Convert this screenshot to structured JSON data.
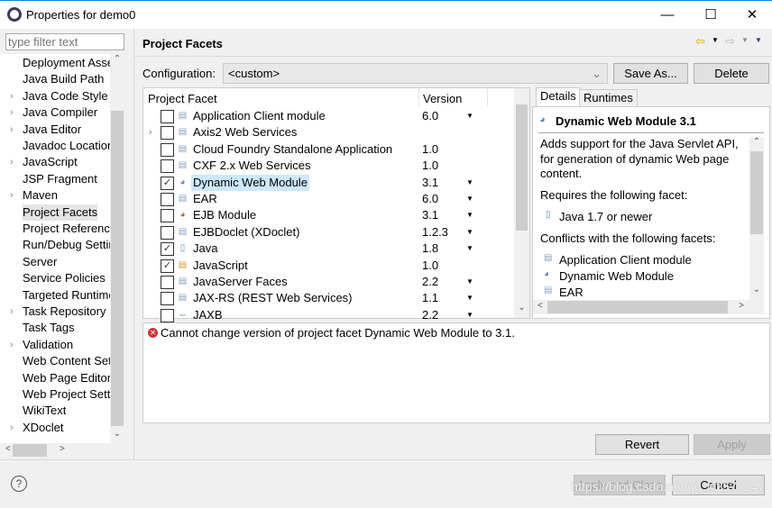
{
  "window": {
    "title": "Properties for demo0",
    "minimize": "—",
    "maximize": "☐",
    "close": "✕"
  },
  "filter": {
    "placeholder": "type filter text"
  },
  "sidebar": {
    "items": [
      {
        "label": "Deployment Assembly",
        "expandable": false
      },
      {
        "label": "Java Build Path",
        "expandable": false
      },
      {
        "label": "Java Code Style",
        "expandable": true
      },
      {
        "label": "Java Compiler",
        "expandable": true
      },
      {
        "label": "Java Editor",
        "expandable": true
      },
      {
        "label": "Javadoc Location",
        "expandable": false
      },
      {
        "label": "JavaScript",
        "expandable": true
      },
      {
        "label": "JSP Fragment",
        "expandable": false
      },
      {
        "label": "Maven",
        "expandable": true
      },
      {
        "label": "Project Facets",
        "expandable": false,
        "selected": true
      },
      {
        "label": "Project References",
        "expandable": false
      },
      {
        "label": "Run/Debug Settings",
        "expandable": false
      },
      {
        "label": "Server",
        "expandable": false
      },
      {
        "label": "Service Policies",
        "expandable": false
      },
      {
        "label": "Targeted Runtimes",
        "expandable": false
      },
      {
        "label": "Task Repository",
        "expandable": true
      },
      {
        "label": "Task Tags",
        "expandable": false
      },
      {
        "label": "Validation",
        "expandable": true
      },
      {
        "label": "Web Content Settings",
        "expandable": false
      },
      {
        "label": "Web Page Editor",
        "expandable": false
      },
      {
        "label": "Web Project Settings",
        "expandable": false
      },
      {
        "label": "WikiText",
        "expandable": false
      },
      {
        "label": "XDoclet",
        "expandable": true
      }
    ]
  },
  "header": {
    "title": "Project Facets"
  },
  "configuration": {
    "label": "Configuration:",
    "value": "<custom>",
    "save_as": "Save As...",
    "delete": "Delete"
  },
  "table": {
    "col_facet": "Project Facet",
    "col_version": "Version",
    "rows": [
      {
        "name": "Application Client module",
        "version": "6.0",
        "checked": false,
        "dropdown": true,
        "icon": "doc"
      },
      {
        "name": "Axis2 Web Services",
        "version": "",
        "checked": false,
        "dropdown": false,
        "icon": "doc",
        "expandable": true
      },
      {
        "name": "Cloud Foundry Standalone Application",
        "version": "1.0",
        "checked": false,
        "dropdown": false,
        "icon": "doc"
      },
      {
        "name": "CXF 2.x Web Services",
        "version": "1.0",
        "checked": false,
        "dropdown": false,
        "icon": "doc"
      },
      {
        "name": "Dynamic Web Module",
        "version": "3.1",
        "checked": true,
        "dropdown": true,
        "icon": "web",
        "selected": true
      },
      {
        "name": "EAR",
        "version": "6.0",
        "checked": false,
        "dropdown": true,
        "icon": "doc"
      },
      {
        "name": "EJB Module",
        "version": "3.1",
        "checked": false,
        "dropdown": true,
        "icon": "ejb"
      },
      {
        "name": "EJBDoclet (XDoclet)",
        "version": "1.2.3",
        "checked": false,
        "dropdown": true,
        "icon": "doc"
      },
      {
        "name": "Java",
        "version": "1.8",
        "checked": true,
        "dropdown": true,
        "icon": "java"
      },
      {
        "name": "JavaScript",
        "version": "1.0",
        "checked": true,
        "dropdown": false,
        "icon": "lock"
      },
      {
        "name": "JavaServer Faces",
        "version": "2.2",
        "checked": false,
        "dropdown": true,
        "icon": "doc"
      },
      {
        "name": "JAX-RS (REST Web Services)",
        "version": "1.1",
        "checked": false,
        "dropdown": true,
        "icon": "doc"
      },
      {
        "name": "JAXB",
        "version": "2.2",
        "checked": false,
        "dropdown": true,
        "icon": "jaxb"
      }
    ]
  },
  "details": {
    "tab_details": "Details",
    "tab_runtimes": "Runtimes",
    "title": "Dynamic Web Module 3.1",
    "description": "Adds support for the Java Servlet API, for generation of dynamic Web page content.",
    "requires_label": "Requires the following facet:",
    "requires": [
      "Java 1.7 or newer"
    ],
    "conflicts_label": "Conflicts with the following facets:",
    "conflicts": [
      "Application Client module",
      "Dynamic Web Module",
      "EAR"
    ]
  },
  "error": {
    "message": "Cannot change version of project facet Dynamic Web Module to 3.1."
  },
  "buttons": {
    "revert": "Revert",
    "apply": "Apply",
    "apply_close": "Apply and Close",
    "cancel": "Cancel"
  },
  "watermark": "https://blog.csdn.net/qq_42575247"
}
